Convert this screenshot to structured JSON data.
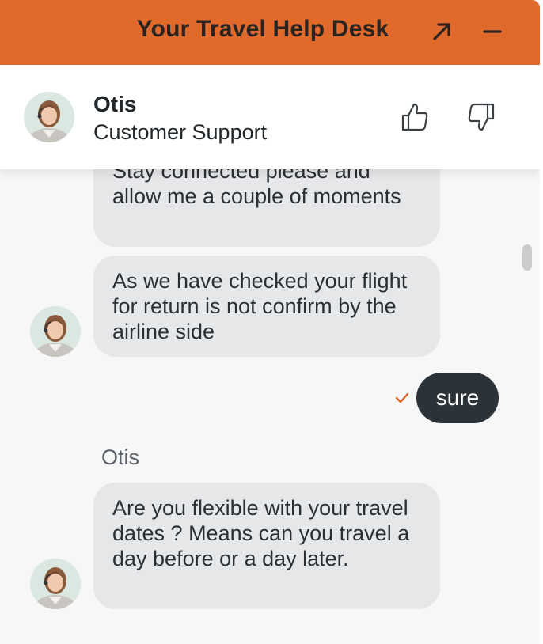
{
  "header": {
    "title": "Your Travel Help Desk",
    "expand_icon": "arrow-up-right-icon",
    "minimize_icon": "minus-icon",
    "background_color": "#e0692c"
  },
  "agent": {
    "name": "Otis",
    "role": "Customer Support",
    "rate_up_icon": "thumbs-up-icon",
    "rate_down_icon": "thumbs-down-icon"
  },
  "messages": [
    {
      "from": "agent",
      "text": "Stay connected please and allow me a couple of moments"
    },
    {
      "from": "agent",
      "text": "As we have checked your flight for return is not confirm by the airline side"
    },
    {
      "from": "user",
      "text": "sure",
      "status_icon": "checkmark-icon"
    },
    {
      "from": "agent",
      "sender_label": "Otis",
      "text": "Are you flexible with your travel dates ? Means can you travel a day before or a day later."
    }
  ],
  "colors": {
    "agent_bubble": "#e6e7e9",
    "user_bubble": "#2b3238",
    "check": "#e0692c"
  }
}
